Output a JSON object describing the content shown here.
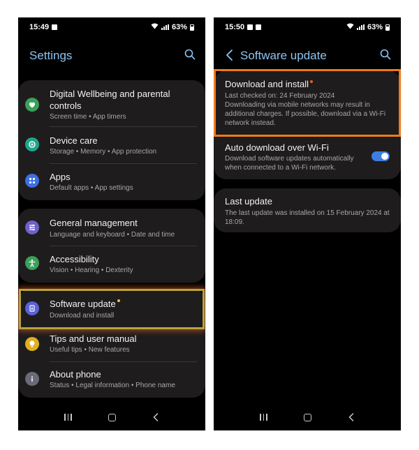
{
  "colors": {
    "accent_title": "#8ec4f2",
    "card_bg": "#1e1c1d",
    "highlight_yellow": "#b8a43c",
    "highlight_orange": "#f07a1a",
    "badge_dot_yellow": "#e8c13a",
    "badge_dot_orange": "#f05a28",
    "toggle_on": "#3d7fe0"
  },
  "left_phone": {
    "status": {
      "time": "15:49",
      "battery": "63%"
    },
    "title": "Settings",
    "groups": [
      {
        "items": [
          {
            "icon": "digital-wellbeing-icon",
            "icon_color": "#3aa05a",
            "title": "Digital Wellbeing and parental controls",
            "subtitle": "Screen time  •  App timers"
          },
          {
            "icon": "device-care-icon",
            "icon_color": "#1fa58c",
            "title": "Device care",
            "subtitle": "Storage  •  Memory  •  App protection"
          },
          {
            "icon": "apps-icon",
            "icon_color": "#3d6fe0",
            "title": "Apps",
            "subtitle": "Default apps  •  App settings"
          }
        ]
      },
      {
        "items": [
          {
            "icon": "general-management-icon",
            "icon_color": "#6e62c8",
            "title": "General management",
            "subtitle": "Language and keyboard  •  Date and time"
          },
          {
            "icon": "accessibility-icon",
            "icon_color": "#3aa05a",
            "title": "Accessibility",
            "subtitle": "Vision  •  Hearing  •  Dexterity"
          }
        ]
      },
      {
        "items": [
          {
            "icon": "software-update-icon",
            "icon_color": "#5a62d8",
            "title": "Software update",
            "subtitle": "Download and install"
          },
          {
            "icon": "tips-icon",
            "icon_color": "#e0b020",
            "title": "Tips and user manual",
            "subtitle": "Useful tips  •  New features"
          },
          {
            "icon": "about-phone-icon",
            "icon_color": "#6a6a78",
            "title": "About phone",
            "subtitle": "Status  •  Legal information  •  Phone name"
          }
        ]
      }
    ]
  },
  "right_phone": {
    "status": {
      "time": "15:50",
      "battery": "63%"
    },
    "title": "Software update",
    "download": {
      "title": "Download and install",
      "checked": "Last checked on: 24 February 2024",
      "note": "Downloading via mobile networks may result in additional charges. If possible, download via a Wi-Fi network instead."
    },
    "auto": {
      "title": "Auto download over Wi-Fi",
      "desc": "Download software updates automatically when connected to a Wi-Fi network.",
      "enabled": true
    },
    "last_update": {
      "title": "Last update",
      "desc": "The last update was installed on 15 February 2024 at 18:09."
    }
  }
}
